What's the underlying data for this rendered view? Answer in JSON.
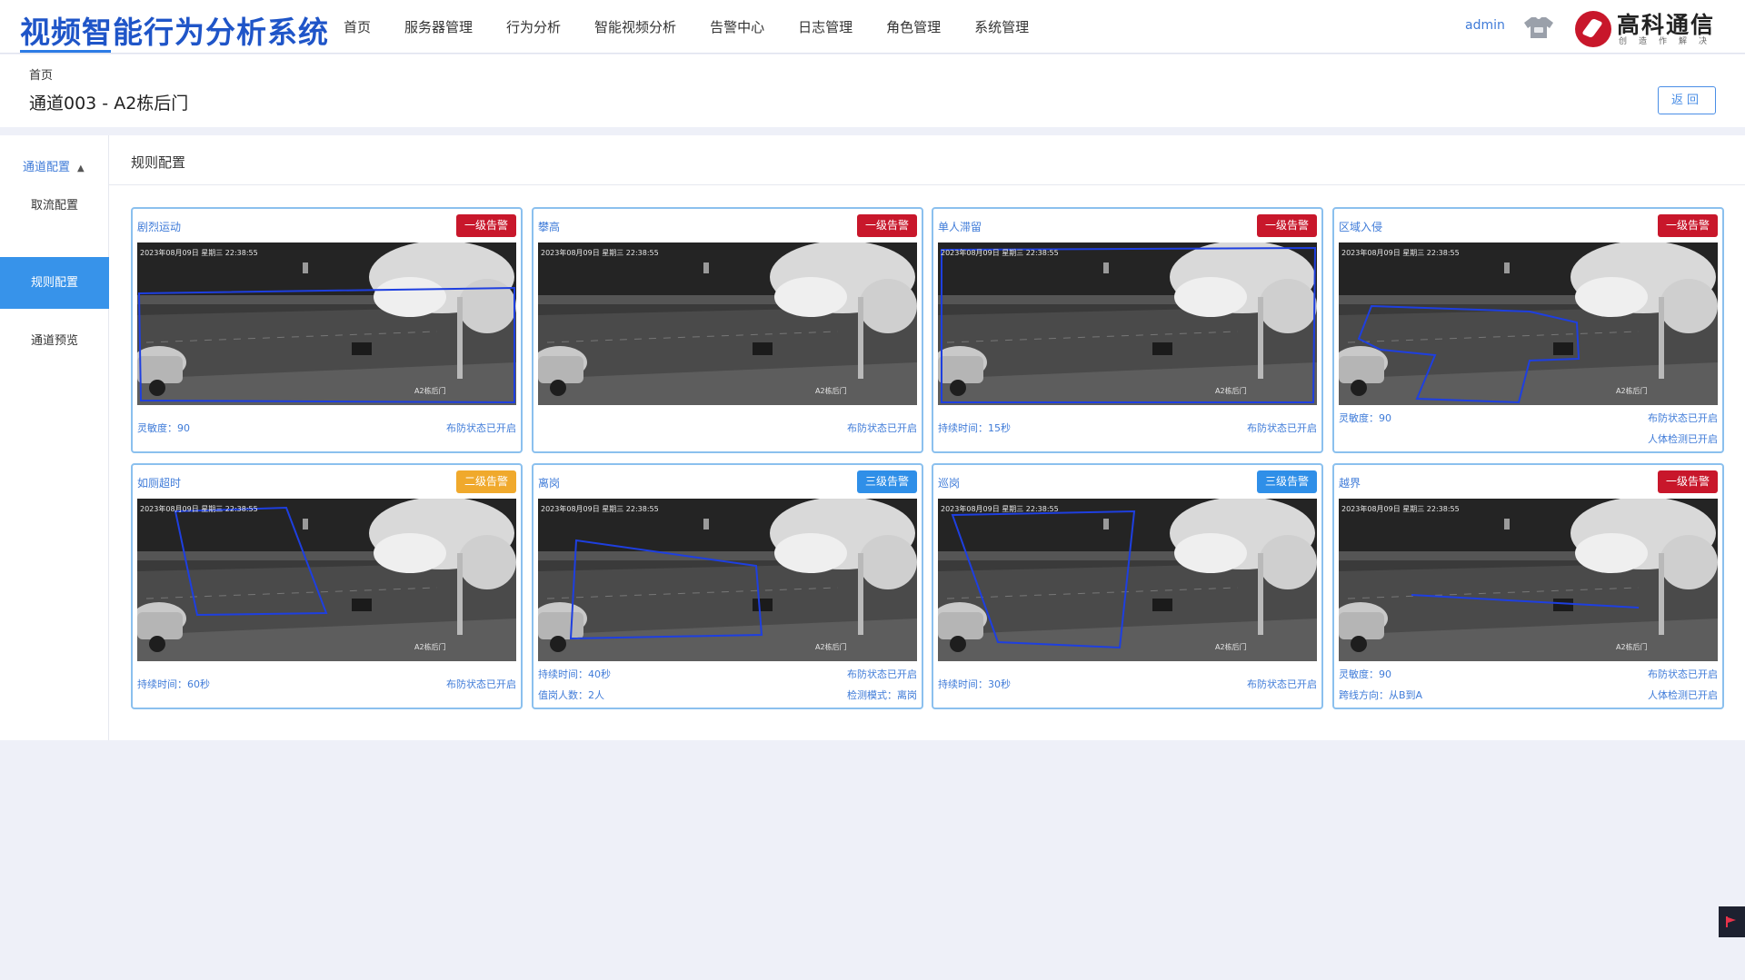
{
  "app_title": "视频智能行为分析系统",
  "nav": [
    "首页",
    "服务器管理",
    "行为分析",
    "智能视频分析",
    "告警中心",
    "日志管理",
    "角色管理",
    "系统管理"
  ],
  "user": "admin",
  "logo": {
    "name": "高科通信",
    "sub": "创造作解决"
  },
  "breadcrumb": "首页",
  "page_title": "通道003 - A2栋后门",
  "back_button": "返回",
  "sidebar": {
    "group": "通道配置",
    "items": [
      "取流配置",
      "规则配置",
      "通道预览"
    ],
    "active": "规则配置"
  },
  "main_title": "规则配置",
  "colors": {
    "level1": "#c8172b",
    "level2": "#f0a92c",
    "level3": "#2f8fe8",
    "roi": "#1e3fe0"
  },
  "feed_overlay": {
    "timestamp": "2023年08月09日 星期三 22:38:55",
    "camera": "A2栋后门"
  },
  "cards": [
    {
      "name": "剧烈运动",
      "badge": "一级告警",
      "level": 1,
      "info_left": [
        "灵敏度：90"
      ],
      "info_right": [
        "布防状态已开启"
      ]
    },
    {
      "name": "攀高",
      "badge": "一级告警",
      "level": 1,
      "info_left": [],
      "info_right": [
        "布防状态已开启"
      ]
    },
    {
      "name": "单人滞留",
      "badge": "一级告警",
      "level": 1,
      "info_left": [
        "持续时间：15秒"
      ],
      "info_right": [
        "布防状态已开启"
      ]
    },
    {
      "name": "区域入侵",
      "badge": "一级告警",
      "level": 1,
      "info_left": [
        "灵敏度：90"
      ],
      "info_right": [
        "布防状态已开启",
        "人体检测已开启"
      ]
    },
    {
      "name": "如厕超时",
      "badge": "二级告警",
      "level": 2,
      "info_left": [
        "持续时间：60秒"
      ],
      "info_right": [
        "布防状态已开启"
      ]
    },
    {
      "name": "离岗",
      "badge": "三级告警",
      "level": 3,
      "info_left": [
        "持续时间：40秒",
        "值岗人数：2人"
      ],
      "info_right": [
        "布防状态已开启",
        "检测模式：离岗"
      ]
    },
    {
      "name": "巡岗",
      "badge": "三级告警",
      "level": 3,
      "info_left": [
        "持续时间：30秒"
      ],
      "info_right": [
        "布防状态已开启"
      ]
    },
    {
      "name": "越界",
      "badge": "一级告警",
      "level": 1,
      "info_left": [
        "灵敏度：90",
        "跨线方向：从B到A"
      ],
      "info_right": [
        "布防状态已开启",
        "人体检测已开启"
      ]
    }
  ]
}
